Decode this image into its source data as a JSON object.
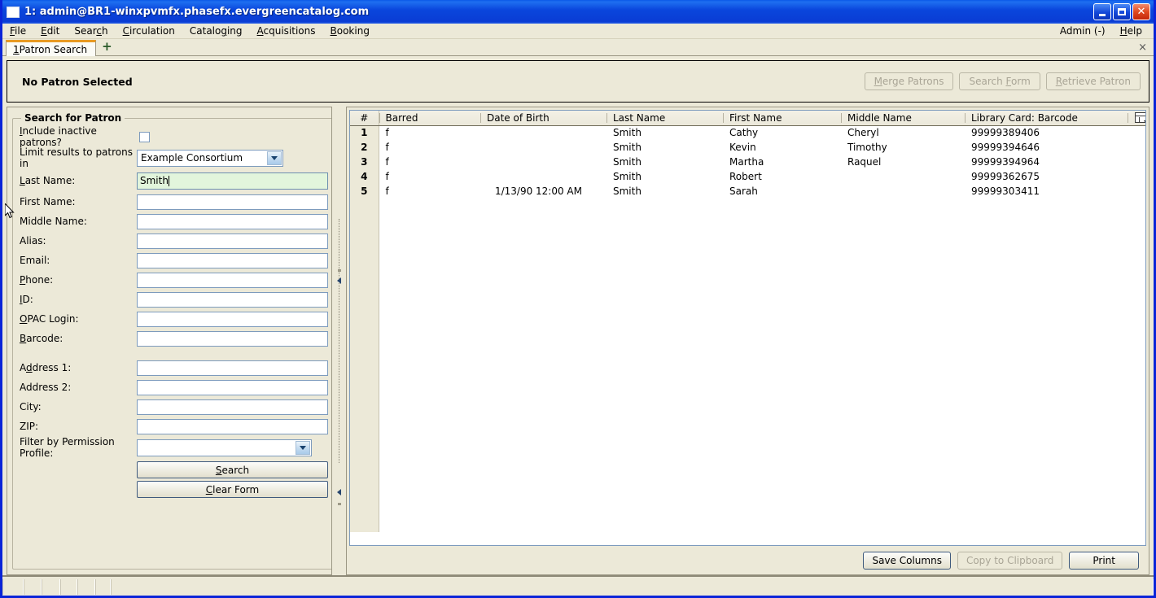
{
  "window": {
    "title": "1: admin@BR1-winxpvmfx.phasefx.evergreencatalog.com",
    "minimize_label": "Minimize",
    "maximize_label": "Maximize",
    "close_label": "Close"
  },
  "menubar": {
    "items": [
      {
        "label": "File",
        "accel": "F"
      },
      {
        "label": "Edit",
        "accel": "E"
      },
      {
        "label": "Search",
        "accel": "c"
      },
      {
        "label": "Circulation",
        "accel": "C"
      },
      {
        "label": "Cataloging",
        "accel": "g"
      },
      {
        "label": "Acquisitions",
        "accel": "A"
      },
      {
        "label": "Booking",
        "accel": "B"
      }
    ],
    "right": [
      {
        "label": "Admin (-)"
      },
      {
        "label": "Help",
        "accel": "H"
      }
    ]
  },
  "tabbar": {
    "tab_number": "1",
    "tab_label": " Patron Search",
    "new_tab_label": "+",
    "close_label": "×"
  },
  "patron_header": {
    "title": "No Patron Selected",
    "buttons": [
      {
        "label_pre": "M",
        "label_accel": "M",
        "label": "Merge Patrons",
        "name": "merge-patrons-button",
        "disabled": true
      },
      {
        "label": "Search Form",
        "name": "search-form-button",
        "disabled": true
      },
      {
        "label": "Retrieve Patron",
        "name": "retrieve-patron-button",
        "disabled": true
      }
    ]
  },
  "search_form": {
    "legend": "Search for Patron",
    "include_inactive_label": "Include inactive patrons?",
    "include_inactive_checked": false,
    "limit_results_label": "Limit results to patrons in",
    "limit_results_value": "Example Consortium",
    "fields": [
      {
        "label": "Last Name:",
        "value": "Smith",
        "focused": true,
        "name": "last-name-field"
      },
      {
        "label": "First Name:",
        "value": "",
        "focused": false,
        "name": "first-name-field"
      },
      {
        "label": "Middle Name:",
        "value": "",
        "focused": false,
        "name": "middle-name-field"
      },
      {
        "label": "Alias:",
        "value": "",
        "focused": false,
        "name": "alias-field"
      },
      {
        "label": "Email:",
        "value": "",
        "focused": false,
        "name": "email-field"
      },
      {
        "label": "Phone:",
        "value": "",
        "focused": false,
        "name": "phone-field"
      },
      {
        "label": "ID:",
        "value": "",
        "focused": false,
        "name": "id-field"
      },
      {
        "label": "OPAC Login:",
        "value": "",
        "focused": false,
        "name": "opac-login-field"
      },
      {
        "label": "Barcode:",
        "value": "",
        "focused": false,
        "name": "barcode-field"
      }
    ],
    "address_fields": [
      {
        "label": "Address 1:",
        "value": "",
        "name": "address-1-field"
      },
      {
        "label": "Address 2:",
        "value": "",
        "name": "address-2-field"
      },
      {
        "label": "City:",
        "value": "",
        "name": "city-field"
      },
      {
        "label": "ZIP:",
        "value": "",
        "name": "zip-field"
      }
    ],
    "permission_profile_label": "Filter by Permission Profile:",
    "permission_profile_value": "",
    "search_button": "Search",
    "clear_form_button": "Clear Form"
  },
  "results": {
    "columns": [
      "#",
      "Barred",
      "Date of Birth",
      "Last Name",
      "First Name",
      "Middle Name",
      "Library Card: Barcode"
    ],
    "rows": [
      {
        "num": "1",
        "barred": "f",
        "dob": "",
        "last": "Smith",
        "first": "Cathy",
        "middle": "Cheryl",
        "barcode": "99999389406"
      },
      {
        "num": "2",
        "barred": "f",
        "dob": "",
        "last": "Smith",
        "first": "Kevin",
        "middle": "Timothy",
        "barcode": "99999394646"
      },
      {
        "num": "3",
        "barred": "f",
        "dob": "",
        "last": "Smith",
        "first": "Martha",
        "middle": "Raquel",
        "barcode": "99999394964"
      },
      {
        "num": "4",
        "barred": "f",
        "dob": "",
        "last": "Smith",
        "first": "Robert",
        "middle": "",
        "barcode": "99999362675"
      },
      {
        "num": "5",
        "barred": "f",
        "dob": "1/13/90 12:00 AM",
        "last": "Smith",
        "first": "Sarah",
        "middle": "",
        "barcode": "99999303411"
      }
    ],
    "buttons": [
      {
        "label": "Save Columns",
        "name": "save-columns-button",
        "disabled": false
      },
      {
        "label": "Copy to Clipboard",
        "name": "copy-to-clipboard-button",
        "disabled": true
      },
      {
        "label": "Print",
        "name": "print-button",
        "disabled": false
      }
    ]
  },
  "statusbar": {
    "cells": [
      "",
      "",
      "",
      "",
      "",
      "",
      ""
    ]
  },
  "colors": {
    "titlebar_blue": "#0a46dc",
    "window_border": "#0a24d8",
    "face": "#ece9d8",
    "field_border": "#7d9bbd",
    "focused_field_bg": "#e2f5dc",
    "tab_accent": "#e89a22",
    "disabled_text": "#a9a596"
  }
}
